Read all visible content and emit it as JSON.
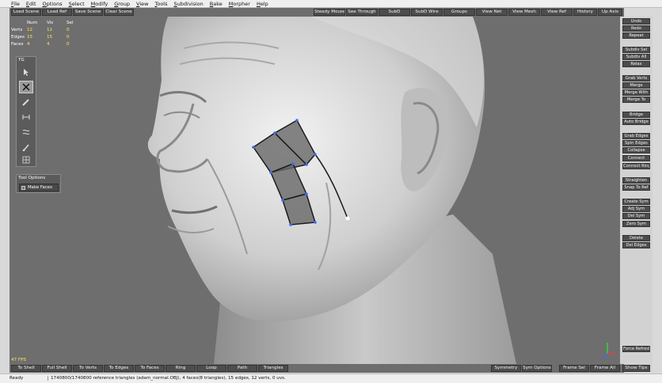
{
  "menubar": [
    "File",
    "Edit",
    "Options",
    "Select",
    "Modify",
    "Group",
    "View",
    "Tools",
    "Subdivision",
    "Bake",
    "Morpher",
    "Help"
  ],
  "toolbar": {
    "left": [
      "Load Scene",
      "Load Ref",
      "Save Scene",
      "Clear Scene"
    ],
    "right": [
      "Steady Mouse",
      "See Through",
      "SubD",
      "SubD Wire",
      "Groups",
      "View Net",
      "View Mesh",
      "View Ref",
      "History",
      "Up Axis"
    ]
  },
  "stats": {
    "headers": [
      "Num",
      "Vis",
      "Sel"
    ],
    "rows": [
      {
        "label": "Verts",
        "num": "12",
        "vis": "12",
        "sel": "0"
      },
      {
        "label": "Edges",
        "num": "15",
        "vis": "15",
        "sel": "0"
      },
      {
        "label": "Faces",
        "num": "4",
        "vis": "4",
        "sel": "0"
      }
    ]
  },
  "tg_panel": {
    "title": "TG",
    "tools": [
      "select-arrow-icon",
      "cross-tool-icon",
      "pen-icon",
      "bridge-icon",
      "relax-icon",
      "brush-icon",
      "grid-icon"
    ]
  },
  "tool_options": {
    "title": "Tool Options",
    "option_label": "Make Faces"
  },
  "fps": "47 FPS",
  "right_panel": {
    "groups": [
      [
        "Undo",
        "Redo",
        "Repeat"
      ],
      [
        "Subdiv Sel",
        "Subdiv All",
        "Relax"
      ],
      [
        "Grab Verts",
        "Merge",
        "Merge With",
        "Merge To"
      ],
      [
        "Bridge",
        "Auto Bridge"
      ],
      [
        "Grab Edges",
        "Spin Edges",
        "Collapse",
        "Connect",
        "Connect Ring"
      ],
      [
        "Straighten",
        "Snap To Ref"
      ],
      [
        "Create Sym",
        "Adj Sym",
        "Del Sym",
        "Zero Sym"
      ],
      [
        "Delete",
        "Del Edges"
      ]
    ],
    "bottom": "Force Refresh"
  },
  "bottombar": {
    "left": [
      "To Shell",
      "Full Shell",
      "To Verts",
      "To Edges",
      "To Faces",
      "Ring",
      "Loop",
      "Path",
      "Triangles"
    ],
    "right": [
      "Symmetry",
      "Sym Options",
      "Frame Sel",
      "Frame All",
      "Show Tips"
    ]
  },
  "status": {
    "ready": "Ready",
    "text": "1740800/1740800 reference triangles (adam_normal.OBJ), 4 faces(8 triangles), 15 edges, 12 verts, 0 uvs."
  },
  "colors": {
    "accent_yellow": "#ffe45a",
    "button_bg": "#4d4d4d",
    "viewport_bg": "#6e6e6e"
  }
}
